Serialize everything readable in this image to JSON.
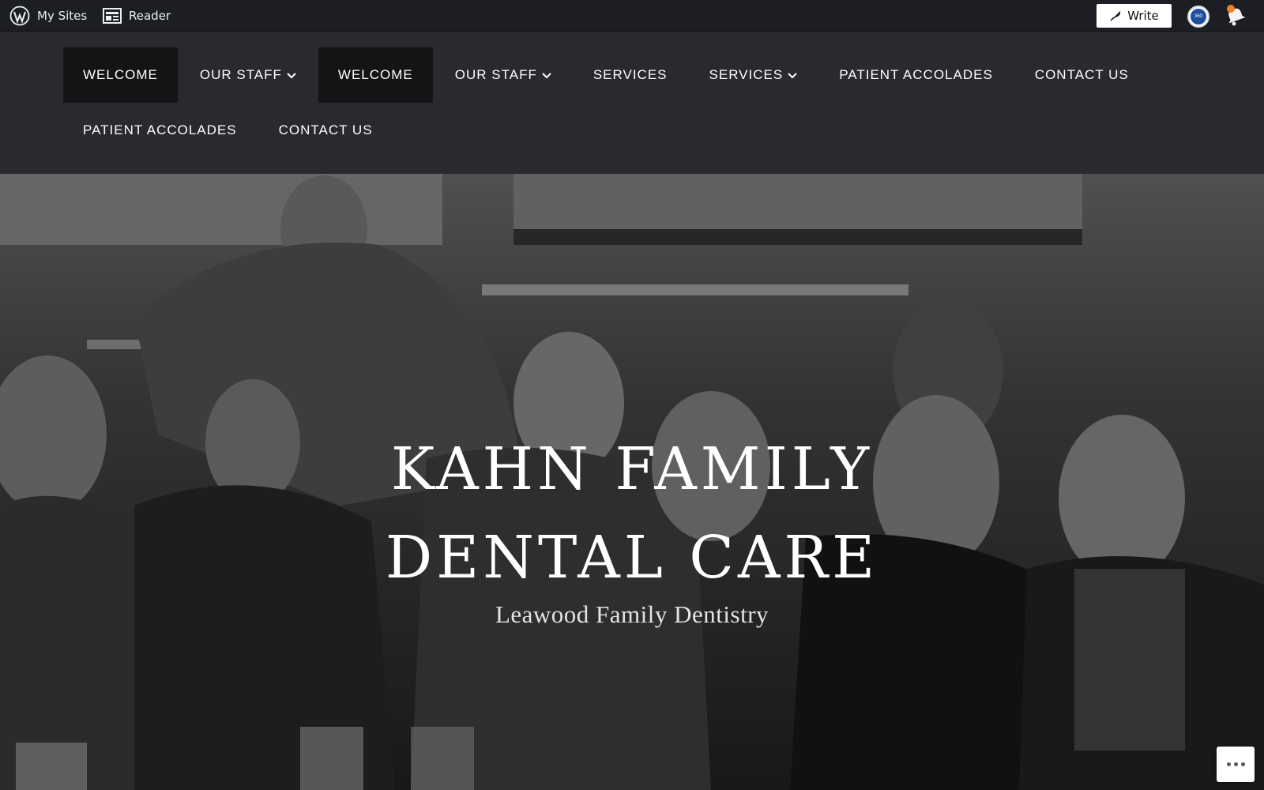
{
  "admin_bar": {
    "my_sites": "My Sites",
    "reader": "Reader",
    "write": "Write",
    "avatar_text": "360"
  },
  "nav": {
    "items": [
      {
        "label": "WELCOME",
        "dropdown": false,
        "active": true
      },
      {
        "label": "OUR STAFF",
        "dropdown": true,
        "active": false
      },
      {
        "label": "WELCOME",
        "dropdown": false,
        "active": true
      },
      {
        "label": "OUR STAFF",
        "dropdown": true,
        "active": false
      },
      {
        "label": "SERVICES",
        "dropdown": false,
        "active": false
      },
      {
        "label": "SERVICES",
        "dropdown": true,
        "active": false
      },
      {
        "label": "PATIENT ACCOLADES",
        "dropdown": false,
        "active": false
      },
      {
        "label": "CONTACT US",
        "dropdown": false,
        "active": false
      },
      {
        "label": "PATIENT ACCOLADES",
        "dropdown": false,
        "active": false
      },
      {
        "label": "CONTACT US",
        "dropdown": false,
        "active": false
      }
    ]
  },
  "hero": {
    "title_line1": "KAHN FAMILY",
    "title_line2": "DENTAL CARE",
    "subtitle": "Leawood Family Dentistry"
  },
  "colors": {
    "admin_bar_bg": "#1c1e24",
    "nav_bg": "#29292e",
    "nav_active_bg": "#141416",
    "notification_dot": "#f0821e"
  }
}
